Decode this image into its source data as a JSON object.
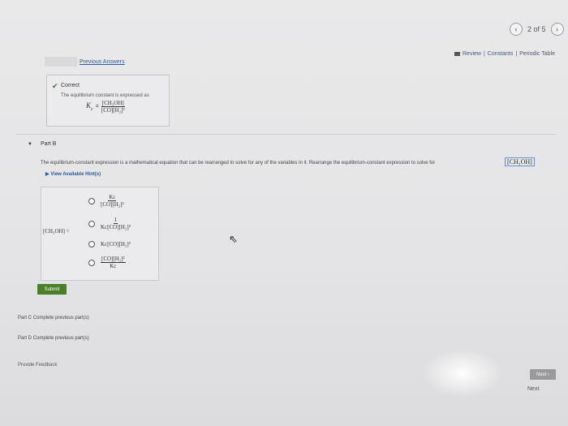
{
  "pager": {
    "prev": "‹",
    "text": "2 of 5",
    "next": "›"
  },
  "topnav": {
    "review": "Review",
    "sep": "|",
    "constants": "Constants",
    "sep2": "|",
    "periodic": "Periodic Table"
  },
  "previous_answers": "Previous Answers",
  "correct": {
    "label": "Correct",
    "description": "The equilibrium constant is expressed as",
    "kc": "K",
    "kc_sub": "c",
    "eq": "=",
    "numerator": "[CH₃OH]",
    "denominator": "[CO][H₂]²"
  },
  "part_b": {
    "label": "Part B",
    "instruction": "The equilibrium-constant expression is a mathematical equation that can be rearranged to solve for any of the variables in it. Rearrange the equilibrium-constant expression to solve for",
    "target": "[CH₃OH]",
    "hints": "View Available Hint(s)",
    "lhs": "[CH₃OH] =",
    "options": [
      {
        "num": "Kc",
        "den": "[CO][H₂]²"
      },
      {
        "num": "1",
        "den": "Kc[CO][H₂]²"
      },
      {
        "text": "Kc[CO][H₂]²"
      },
      {
        "num": "[CO][H₂]²",
        "den": "Kc"
      }
    ],
    "submit": "Submit"
  },
  "part_c": {
    "label": "Part C",
    "status": "Complete previous part(s)"
  },
  "part_d": {
    "label": "Part D",
    "status": "Complete previous part(s)"
  },
  "feedback": "Provide Feedback",
  "next": "Next ›",
  "next2": "Next"
}
